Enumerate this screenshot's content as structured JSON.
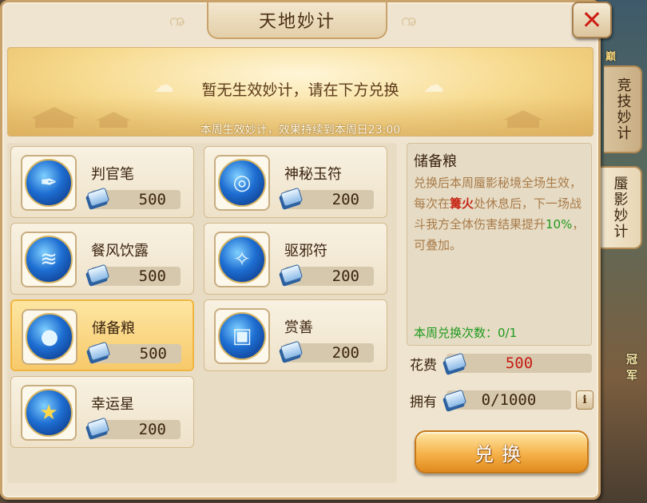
{
  "window": {
    "title": "天地妙计",
    "close_icon": "close-icon"
  },
  "banner": {
    "message": "暂无生效妙计，请在下方兑换",
    "sub_message": "本周生效妙计，效果持续到本周日23:00"
  },
  "items": [
    {
      "name": "判官笔",
      "price": "500",
      "icon": "brush-icon"
    },
    {
      "name": "神秘玉符",
      "price": "200",
      "icon": "jade-talisman-icon"
    },
    {
      "name": "餐风饮露",
      "price": "500",
      "icon": "wind-dew-icon"
    },
    {
      "name": "驱邪符",
      "price": "200",
      "icon": "exorcism-charm-icon"
    },
    {
      "name": "储备粮",
      "price": "500",
      "icon": "grain-sack-icon",
      "selected": true
    },
    {
      "name": "赏善",
      "price": "200",
      "icon": "gift-box-icon"
    },
    {
      "name": "幸运星",
      "price": "200",
      "icon": "lucky-star-icon"
    }
  ],
  "detail": {
    "title": "储备粮",
    "desc_part1": "兑换后本周蜃影秘境全场生效，每次在",
    "desc_highlight": "篝火",
    "desc_part2": "处休息后，下一场战斗我方全体伤害结果提升",
    "desc_percent": "10%",
    "desc_part3": "，可叠加。",
    "weekly_count": "本周兑换次数：0/1"
  },
  "cost": {
    "label": "花费",
    "value": "500"
  },
  "own": {
    "label": "拥有",
    "value": "0/1000",
    "info_label": "i"
  },
  "exchange_button": {
    "label": "兑换"
  },
  "side_tabs": [
    {
      "label": "竞技妙计",
      "active": false
    },
    {
      "label": "蜃影妙计",
      "active": true
    }
  ],
  "background": {
    "scene_text_1": "巅",
    "scene_text_2": "冠军"
  },
  "colors": {
    "accent_red": "#c62717",
    "accent_green": "#1e9a1e",
    "selected_gold": "#f7c96a"
  }
}
